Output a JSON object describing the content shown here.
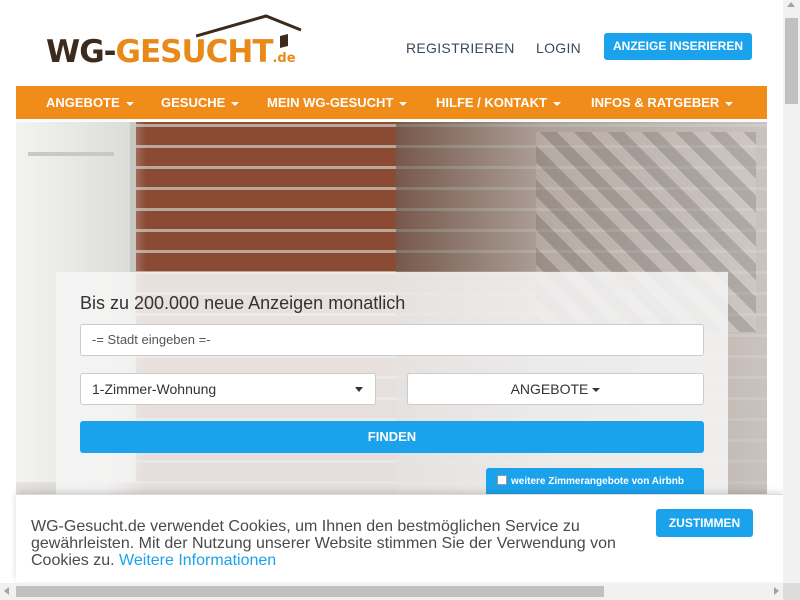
{
  "header": {
    "logo": {
      "part1": "WG-",
      "part2": "GESUCHT",
      "tld": ".de"
    },
    "links": [
      "REGISTRIEREN",
      "LOGIN"
    ],
    "cta": "ANZEIGE INSERIEREN"
  },
  "menu": [
    "ANGEBOTE",
    "GESUCHE",
    "MEIN WG-GESUCHT",
    "HILFE / KONTAKT",
    "INFOS & RATGEBER"
  ],
  "search": {
    "title": "Bis zu 200.000 neue Anzeigen monatlich",
    "city_placeholder": "-= Stadt eingeben =-",
    "type_selected": "1-Zimmer-Wohnung",
    "offers_label": "ANGEBOTE",
    "find_label": "FINDEN",
    "airbnb_label": "weitere Zimmerangebote von Airbnb"
  },
  "cookie": {
    "text": "WG-Gesucht.de verwendet Cookies, um Ihnen den bestmöglichen Service zu gewährleisten. Mit der Nutzung unserer Website stimmen Sie der Verwendung von Cookies zu.",
    "link": "Weitere Informationen",
    "accept": "ZUSTIMMEN"
  },
  "colors": {
    "orange": "#f08c1a",
    "blue": "#1aa3ec",
    "brown": "#3c2a1d"
  }
}
